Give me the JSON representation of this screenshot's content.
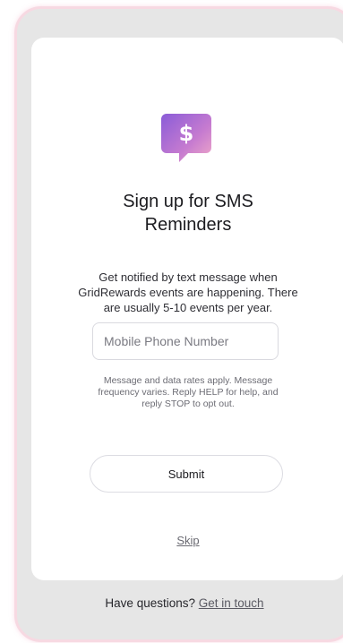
{
  "signup": {
    "title": "Sign up for SMS Reminders",
    "description": "Get notified by text message when GridRewards events are happening. There are usually 5-10 events per year.",
    "phone_placeholder": "Mobile Phone Number",
    "disclaimer": "Message and data rates apply. Message frequency varies. Reply HELP for help, and reply STOP to opt out.",
    "submit_label": "Submit",
    "skip_label": "Skip"
  },
  "footer": {
    "question": "Have questions?",
    "link_label": "Get in touch"
  },
  "icons": {
    "logo": "dollar-chat-bubble-icon"
  },
  "colors": {
    "logo_gradient_start": "#8a5cd8",
    "logo_gradient_end": "#f0a9c8"
  }
}
